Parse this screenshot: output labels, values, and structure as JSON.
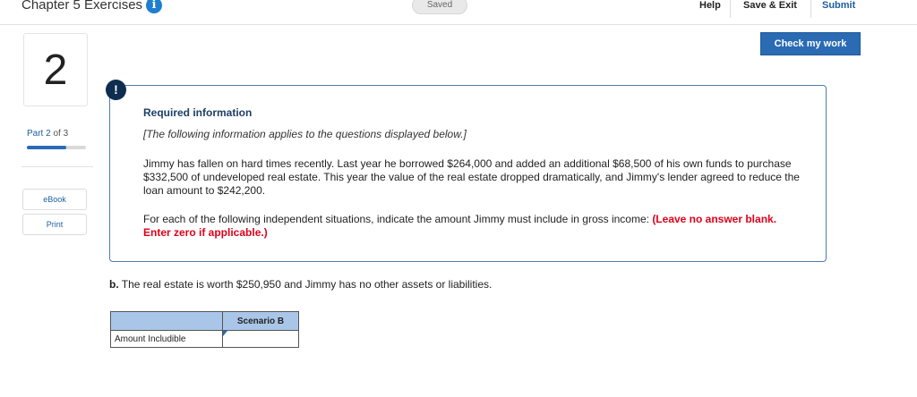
{
  "header": {
    "assignment_title": "Chapter 5 Exercises II",
    "info_icon": "i",
    "saved_status": "Saved",
    "help_label": "Help",
    "save_exit_label": "Save & Exit",
    "submit_label": "Submit",
    "check_work_label": "Check my work"
  },
  "sidebar": {
    "question_number": "2",
    "part_prefix": "Part",
    "part_current": "2",
    "part_suffix": "of 3",
    "progress_fraction": 0.6667,
    "ebook_label": "eBook",
    "print_label": "Print"
  },
  "info_box": {
    "alert_icon": "!",
    "title": "Required information",
    "subtitle": "[The following information applies to the questions displayed below.]",
    "body": "Jimmy has fallen on hard times recently. Last year he borrowed $264,000 and added an additional $68,500 of his own funds to purchase $332,500 of undeveloped real estate. This year the value of the real estate dropped dramatically, and Jimmy's lender agreed to reduce the loan amount to $242,200.",
    "instruction": "For each of the following independent situations, indicate the amount Jimmy must include in gross income:",
    "instruction_emphasis": "(Leave no answer blank. Enter zero if applicable.)"
  },
  "question": {
    "letter": "b.",
    "text": "The real estate is worth $250,950 and Jimmy has no other assets or liabilities."
  },
  "answer_table": {
    "column_header": "Scenario B",
    "row_label": "Amount Includible",
    "value": ""
  },
  "colors": {
    "accent": "#2a6bb4",
    "alert_red": "#e1001a",
    "table_header": "#a9c6e8"
  }
}
